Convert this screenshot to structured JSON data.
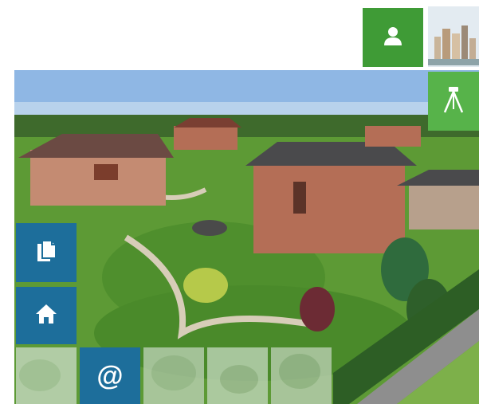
{
  "colors": {
    "tile_blue": "#1d6e9b",
    "tile_green": "#3f9b36",
    "tile_green_light": "#57b34a",
    "sky": "#8fb7e4",
    "lawn": "#4f8f2d",
    "roof": "#4a4a4c",
    "brick": "#b46e56"
  },
  "tiles": {
    "profile": {
      "icon": "user-icon"
    },
    "cityscape": {
      "icon": "cityscape-thumbnail"
    },
    "survey": {
      "icon": "tripod-icon"
    },
    "documents": {
      "icon": "documents-icon"
    },
    "home": {
      "icon": "home-icon"
    },
    "email": {
      "icon": "at-icon",
      "label": "@"
    }
  },
  "photo": {
    "subject": "residential-estate-aerial-photo"
  }
}
